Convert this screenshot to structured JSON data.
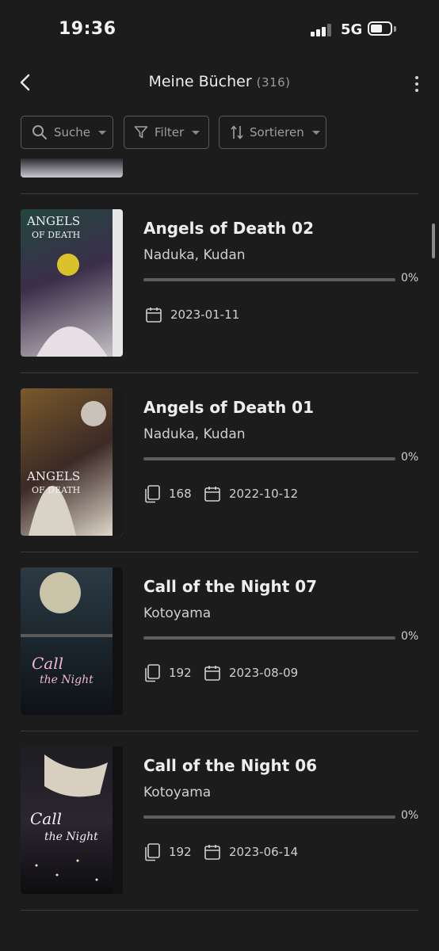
{
  "status": {
    "time": "19:36",
    "network": "5G"
  },
  "header": {
    "title": "Meine Bücher",
    "count": "(316)"
  },
  "toolbar": {
    "search": "Suche",
    "filter": "Filter",
    "sort": "Sortieren"
  },
  "books": [
    {
      "title": "Angels of Death 02",
      "author": "Naduka, Kudan",
      "progress_pct": "0%",
      "progress": 0,
      "pages": "",
      "date": "2023-01-11",
      "colors": [
        "#1f3a35",
        "#b8c2c4"
      ]
    },
    {
      "title": "Angels of Death 01",
      "author": "Naduka, Kudan",
      "progress_pct": "0%",
      "progress": 0,
      "pages": "168",
      "date": "2022-10-12",
      "colors": [
        "#6b4a1e",
        "#3a2a2a"
      ]
    },
    {
      "title": "Call of the Night 07",
      "author": "Kotoyama",
      "progress_pct": "0%",
      "progress": 0,
      "pages": "192",
      "date": "2023-08-09",
      "colors": [
        "#1c2a33",
        "#3d4a55"
      ]
    },
    {
      "title": "Call of the Night 06",
      "author": "Kotoyama",
      "progress_pct": "0%",
      "progress": 0,
      "pages": "192",
      "date": "2023-06-14",
      "colors": [
        "#16161a",
        "#8a7a66"
      ]
    }
  ]
}
